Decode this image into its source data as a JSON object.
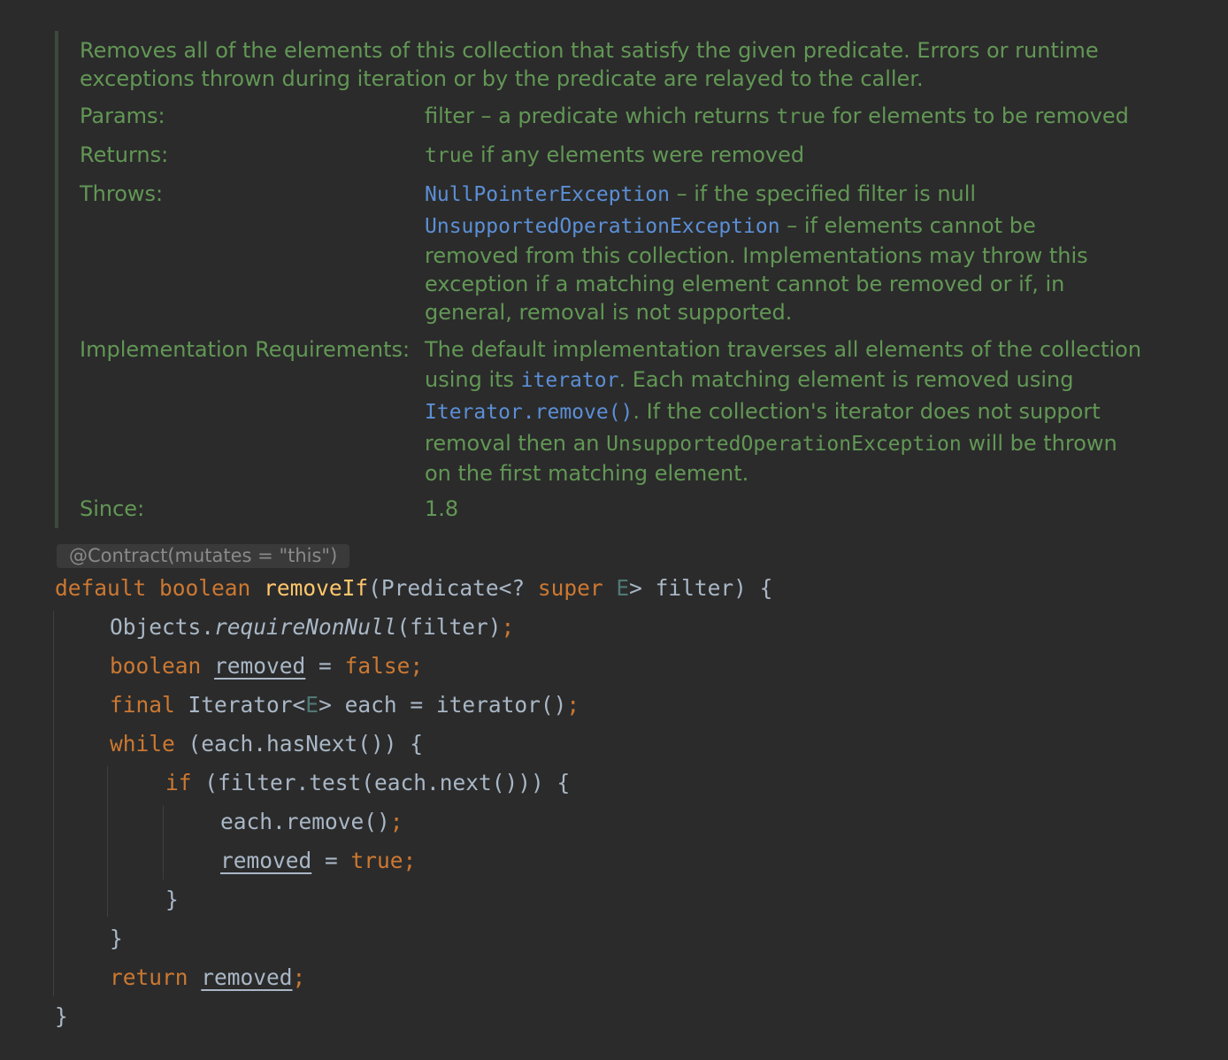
{
  "javadoc": {
    "description": "Removes all of the elements of this collection that satisfy the given predicate. Errors or runtime exceptions thrown during iteration or by the predicate are relayed to the caller.",
    "params": {
      "label": "Params:",
      "name": "filter",
      "dash": " – a predicate which returns ",
      "code_true": "true",
      "rest": " for elements to be removed"
    },
    "returns": {
      "label": "Returns:",
      "code_true": "true",
      "rest": " if any elements were removed"
    },
    "throws": {
      "label": "Throws:",
      "npe_link": "NullPointerException",
      "npe_text": " – if the specified filter is null",
      "uoe_link": "UnsupportedOperationException",
      "uoe_text": " – if elements cannot be",
      "uoe_line2": "removed from this collection. Implementations may throw this",
      "uoe_line3": "exception if a matching element cannot be removed or if, in",
      "uoe_line4": "general, removal is not supported."
    },
    "impl": {
      "label": "Implementation Requirements:",
      "line1": "The default implementation traverses all elements of the collection",
      "line2_a": "using its ",
      "line2_link": "iterator",
      "line2_b": ". Each matching element is removed using",
      "line3_link": "Iterator.remove()",
      "line3_b": ". If the collection's iterator does not support",
      "line4_a": "removal then an ",
      "line4_code": "UnsupportedOperationException",
      "line4_b": " will be thrown",
      "line5": "on the first matching element."
    },
    "since": {
      "label": "Since:",
      "value": "1.8"
    }
  },
  "annotation": "@Contract(mutates = \"this\")",
  "code": {
    "kw_default": "default",
    "kw_boolean": "boolean",
    "kw_super": "super",
    "kw_final": "final",
    "kw_while": "while",
    "kw_if": "if",
    "kw_return": "return",
    "kw_false": "false",
    "kw_true": "true",
    "method_name": "removeIf",
    "predicate_open": "(Predicate<? ",
    "type_param": "E",
    "sig_close": "> filter) {",
    "objects": "Objects.",
    "require_non_null": "requireNonNull",
    "filter_arg": "(filter)",
    "semicolon": ";",
    "var_removed": "removed",
    "assign": " = ",
    "iterator_type": "Iterator<",
    "each_assign": "> each = iterator()",
    "while_cond": "(each.hasNext()) {",
    "if_cond": "(filter.test(each.next())) {",
    "each_remove": "each.remove()",
    "close_brace": "}"
  }
}
